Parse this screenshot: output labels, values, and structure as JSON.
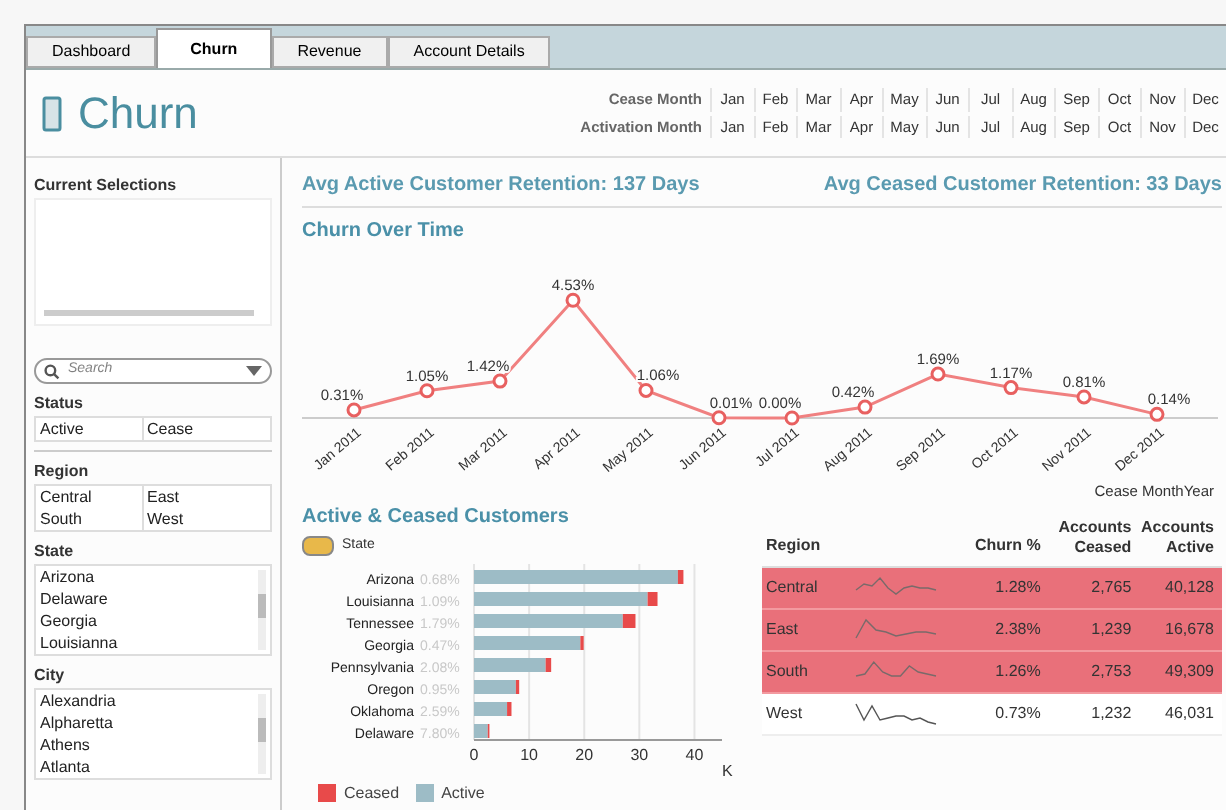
{
  "tabs": [
    {
      "label": "Dashboard",
      "selected": false
    },
    {
      "label": "Churn",
      "selected": true
    },
    {
      "label": "Revenue",
      "selected": false
    },
    {
      "label": "Account Details",
      "selected": false
    }
  ],
  "title": "Churn",
  "month_filters": [
    {
      "label": "Cease Month",
      "months": [
        "Jan",
        "Feb",
        "Mar",
        "Apr",
        "May",
        "Jun",
        "Jul",
        "Aug",
        "Sep",
        "Oct",
        "Nov",
        "Dec"
      ]
    },
    {
      "label": "Activation Month",
      "months": [
        "Jan",
        "Feb",
        "Mar",
        "Apr",
        "May",
        "Jun",
        "Jul",
        "Aug",
        "Sep",
        "Oct",
        "Nov",
        "Dec"
      ]
    }
  ],
  "sidebar": {
    "current_selections": "Current Selections",
    "search": {
      "placeholder": "Search"
    },
    "status": {
      "label": "Status",
      "items": [
        "Active",
        "Cease"
      ]
    },
    "region": {
      "label": "Region",
      "items": [
        "Central",
        "East",
        "South",
        "West"
      ]
    },
    "state": {
      "label": "State",
      "items": [
        "Arizona",
        "Delaware",
        "Georgia",
        "Louisianna"
      ]
    },
    "city": {
      "label": "City",
      "items": [
        "Alexandria",
        "Alpharetta",
        "Athens",
        "Atlanta"
      ]
    }
  },
  "kpis": [
    "Avg Active Customer Retention: 137 Days",
    "Avg Ceased Customer Retention: 33 Days"
  ],
  "line_chart": {
    "chart_data": {
      "type": "line",
      "title": "Churn Over Time",
      "xlabel": "Cease MonthYear",
      "categories": [
        "Jan 2011",
        "Feb 2011",
        "Mar 2011",
        "Apr 2011",
        "May 2011",
        "Jun 2011",
        "Jul 2011",
        "Aug 2011",
        "Sep 2011",
        "Oct 2011",
        "Nov 2011",
        "Dec 2011"
      ],
      "series": [
        {
          "color": "#f08080",
          "marker": "circle",
          "values": [
            0.31,
            1.05,
            1.42,
            4.53,
            1.06,
            0.01,
            0.0,
            0.42,
            1.69,
            1.17,
            0.81,
            0.14
          ],
          "value_labels": [
            "0.31%",
            "1.05%",
            "1.42%",
            "4.53%",
            "1.06%",
            "0.01%",
            "0.00%",
            "0.42%",
            "1.69%",
            "1.17%",
            "0.81%",
            "0.14%"
          ]
        }
      ]
    }
  },
  "bar_chart": {
    "dimension_label": "State",
    "rate_labels": [
      "0.68%",
      "1.09%",
      "1.79%",
      "0.47%",
      "2.08%",
      "0.95%",
      "2.59%",
      "7.80%"
    ],
    "chart_data": {
      "type": "bar",
      "title": "Active & Ceased Customers",
      "orientation": "horizontal",
      "stacked": true,
      "xlabel": "K",
      "categories": [
        "Arizona",
        "Louisianna",
        "Tennessee",
        "Georgia",
        "Pennsylvania",
        "Oregon",
        "Oklahoma",
        "Delaware"
      ],
      "xticks": [
        0,
        10,
        20,
        30,
        40
      ],
      "xlim": [
        0,
        45
      ],
      "grid": true,
      "legend": "bottom",
      "series": [
        {
          "name": "Active",
          "color": "#9dbcc6",
          "values": [
            37,
            31.5,
            27,
            19.3,
            13,
            7.6,
            6,
            2.5
          ]
        },
        {
          "name": "Ceased",
          "color": "#e84a4a",
          "values": [
            1,
            1.8,
            2.3,
            0.6,
            1,
            0.6,
            0.8,
            0.3
          ]
        }
      ]
    }
  },
  "table": {
    "columns": [
      "Region",
      "Churn %",
      "Accounts Ceased",
      "Accounts Active"
    ],
    "rows": [
      {
        "region": "Central",
        "churn": "1.28%",
        "ceased": "2,765",
        "active": "40,128",
        "highlighted": true
      },
      {
        "region": "East",
        "churn": "2.38%",
        "ceased": "1,239",
        "active": "16,678",
        "highlighted": true
      },
      {
        "region": "South",
        "churn": "1.26%",
        "ceased": "2,753",
        "active": "49,309",
        "highlighted": true
      },
      {
        "region": "West",
        "churn": "0.73%",
        "ceased": "1,232",
        "active": "46,031",
        "highlighted": false
      }
    ]
  }
}
